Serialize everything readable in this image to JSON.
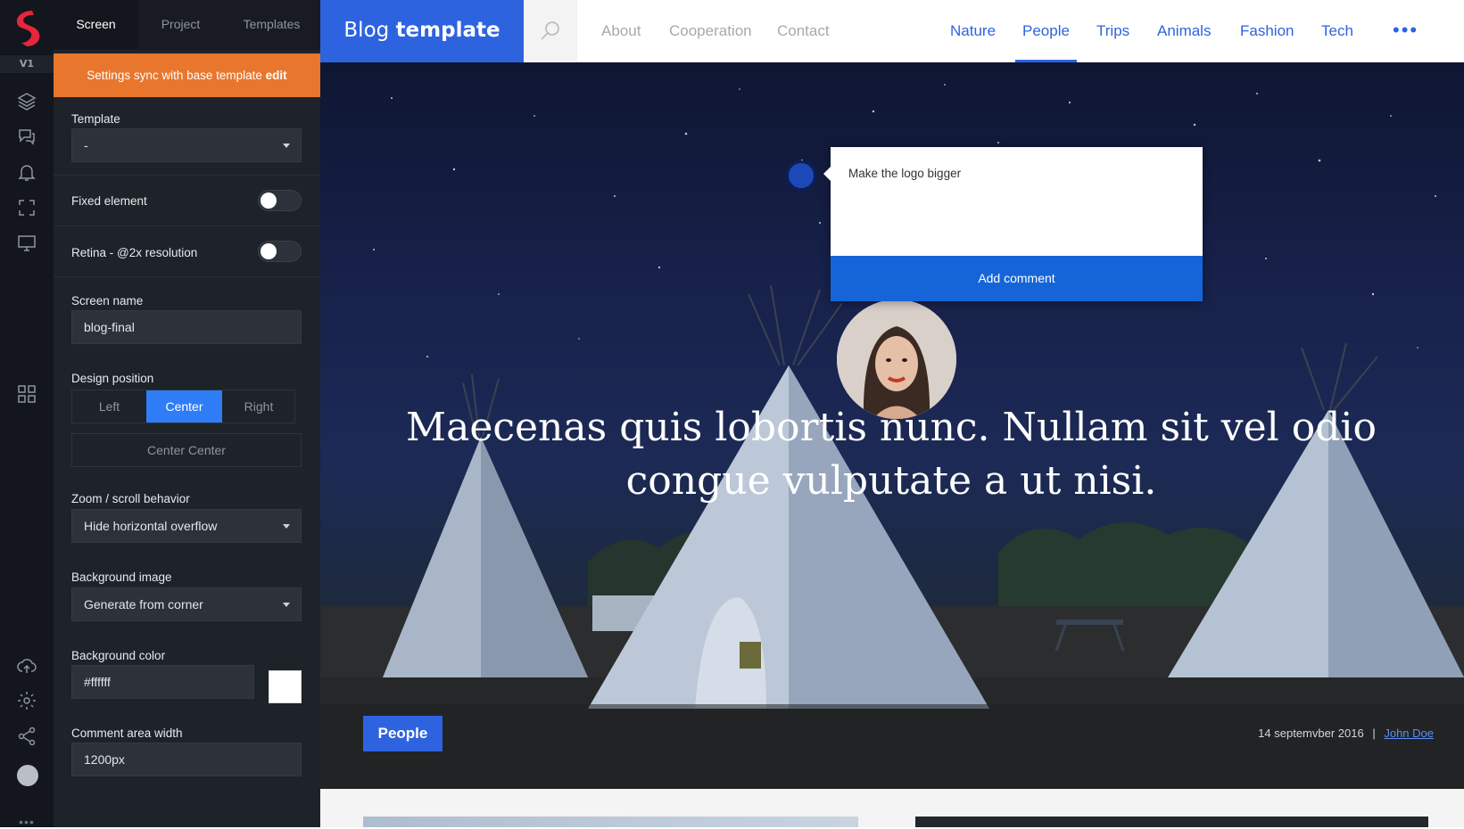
{
  "rail": {
    "version": "V1",
    "icons": [
      "layers-icon",
      "comments-icon",
      "bell-icon",
      "fullscreen-icon",
      "monitor-icon",
      "grid-icon",
      "cloud-upload-icon",
      "settings-icon",
      "share-icon",
      "avatar"
    ]
  },
  "panel": {
    "tabs": [
      "Screen",
      "Project",
      "Templates"
    ],
    "sync_text": "Settings sync with base template",
    "sync_link": "edit",
    "template_label": "Template",
    "template_value": "-",
    "fixed_label": "Fixed element",
    "retina_label": "Retina - @2x resolution",
    "screen_name_label": "Screen name",
    "screen_name_value": "blog-final",
    "design_position_label": "Design position",
    "positions": [
      "Left",
      "Center",
      "Right"
    ],
    "selected_position": "Center",
    "center_center": "Center Center",
    "zoom_label": "Zoom / scroll behavior",
    "zoom_value": "Hide horizontal overflow",
    "bg_image_label": "Background image",
    "bg_image_value": "Generate from corner",
    "bg_color_label": "Background color",
    "bg_color_value": "#ffffff",
    "comment_width_label": "Comment area width",
    "comment_width_value": "1200px"
  },
  "site": {
    "brand_light": "Blog",
    "brand_bold": "template",
    "left_links": [
      "About",
      "Cooperation",
      "Contact"
    ],
    "right_links": [
      "Nature",
      "People",
      "Trips",
      "Animals",
      "Fashion",
      "Tech"
    ],
    "active_link": "People",
    "more": "•••",
    "headline": "Maecenas quis lobortis nunc. Nullam sit vel odio congue vulputate a ut nisi.",
    "tag": "People",
    "date": "14 septemvber 2016",
    "meta_sep": "|",
    "author": "John Doe"
  },
  "comment": {
    "text": "Make the logo bigger",
    "button": "Add comment"
  },
  "colors": {
    "accent": "#2e63e0",
    "sync_bar": "#e8762d",
    "panel_bg": "#1e2229",
    "rail_bg": "#13161c",
    "comment_button": "#1565d8"
  }
}
